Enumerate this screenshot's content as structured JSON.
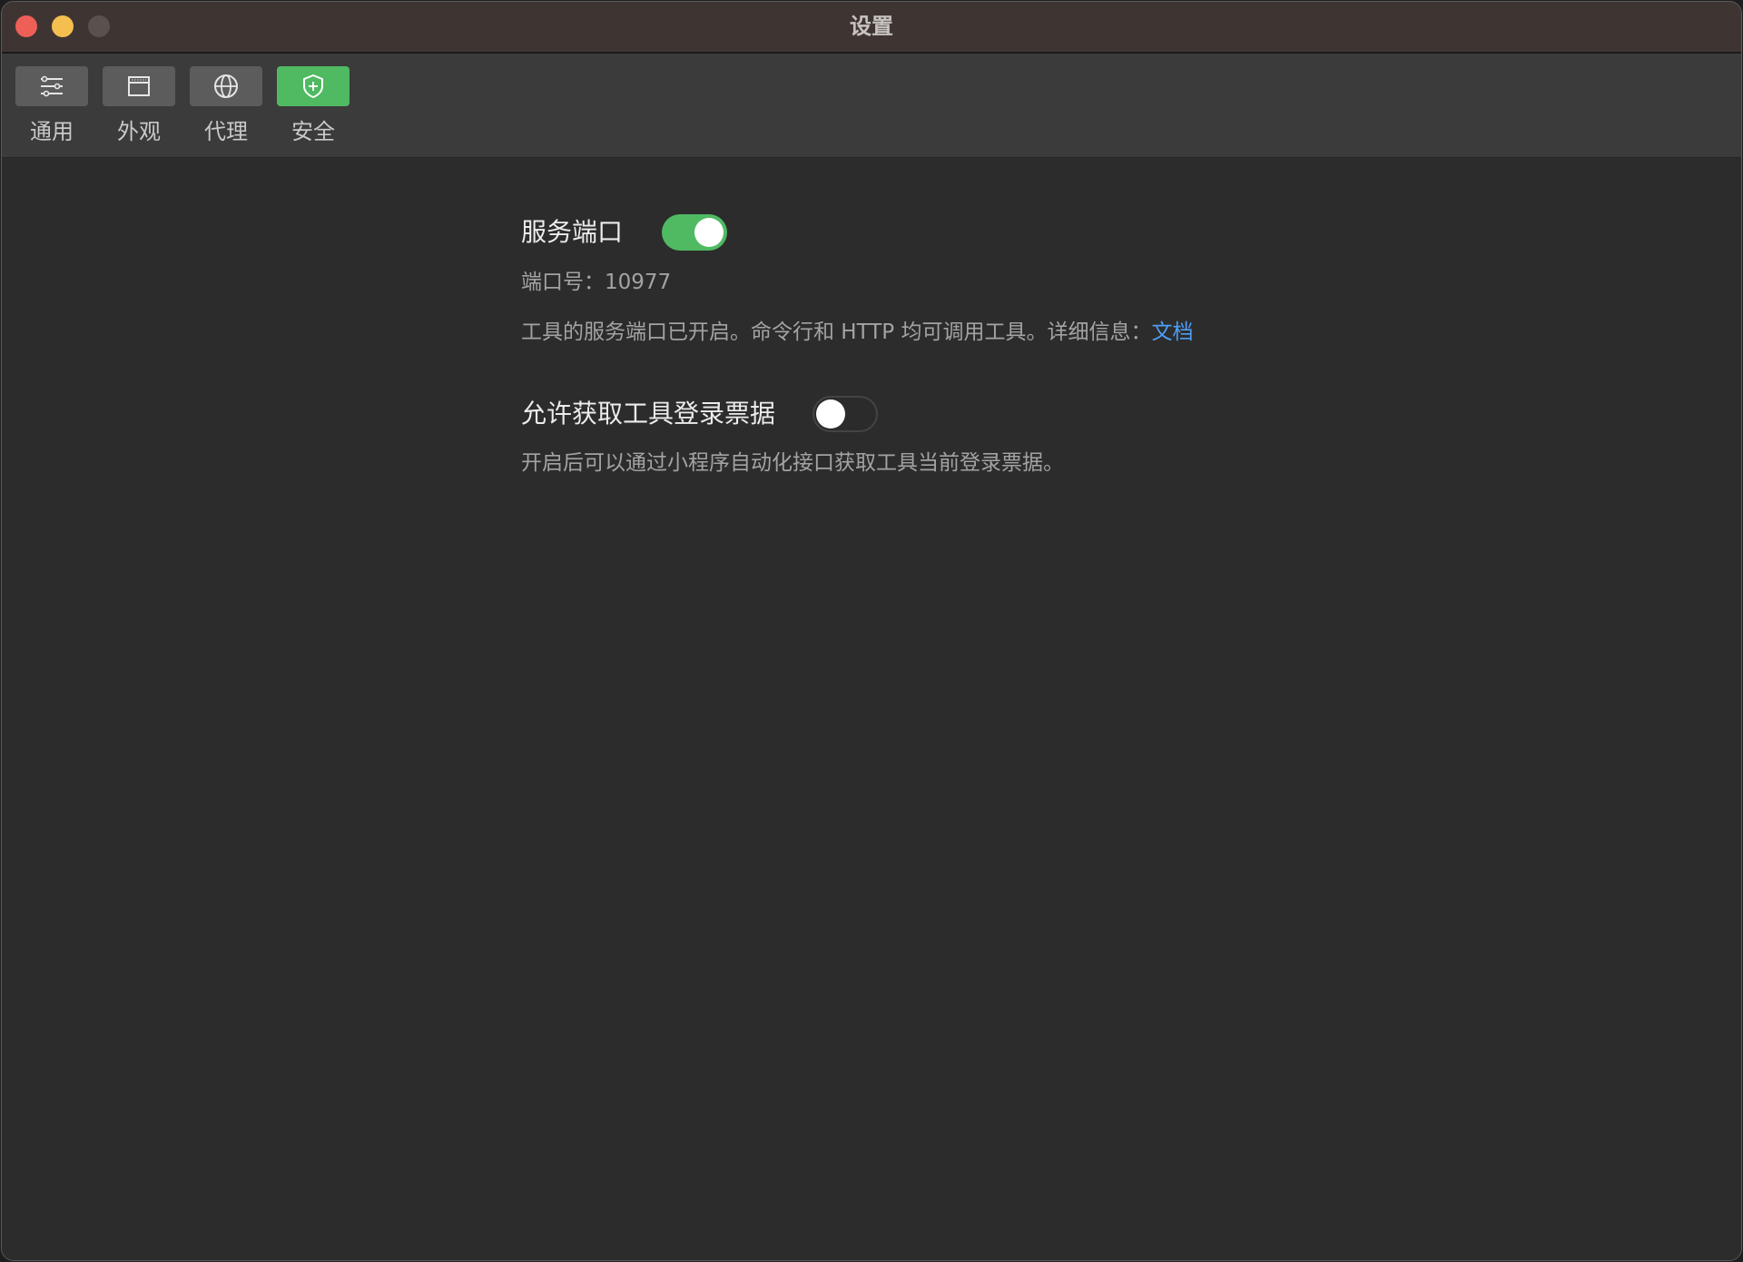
{
  "window": {
    "title": "设置",
    "controls": {
      "close_color": "#ee5f57",
      "minimize_color": "#f5bf4f",
      "maximize_color": "#5a504d"
    }
  },
  "toolbar": {
    "tabs": [
      {
        "label": "通用",
        "icon": "sliders-icon",
        "active": false
      },
      {
        "label": "外观",
        "icon": "window-icon",
        "active": false
      },
      {
        "label": "代理",
        "icon": "globe-icon",
        "active": false
      },
      {
        "label": "安全",
        "icon": "shield-plus-icon",
        "active": true
      }
    ],
    "active_color": "#4fba62"
  },
  "settings": {
    "service_port": {
      "title": "服务端口",
      "enabled": true,
      "port_line": "端口号：10977",
      "description": "工具的服务端口已开启。命令行和 HTTP 均可调用工具。详细信息：",
      "link_text": "文档",
      "link_color": "#4e9ef7"
    },
    "login_ticket": {
      "title": "允许获取工具登录票据",
      "enabled": false,
      "description": "开启后可以通过小程序自动化接口获取工具当前登录票据。"
    }
  }
}
